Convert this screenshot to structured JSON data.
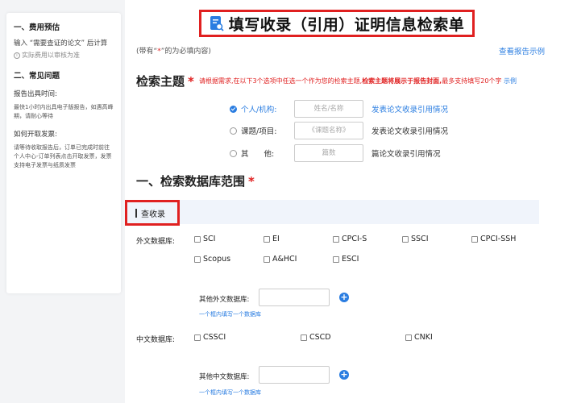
{
  "sidebar": {
    "section1_title": "一、费用预估",
    "section1_text": "输入 “需要查证的论文” 后计算",
    "section1_note": "实际费用以审核为准",
    "section2_title": "二、常见问题",
    "q1_title": "报告出具时间:",
    "q1_text": "最快1小时内出具电子版报告，如遇高峰期，请耐心等待",
    "q2_title": "如何开取发票:",
    "q2_text": "请等待收取报告后，订单已完成时前往个人中心-订单列表点击开取发票，发票支持电子发票与纸质发票"
  },
  "header": {
    "title": "填写收录（引用）证明信息检索单",
    "note_prefix": "(带有“",
    "note_star": "*",
    "note_suffix": "”的为必填内容)",
    "example_link": "查看报告示例"
  },
  "topic": {
    "title": "检索主题",
    "required_mark": "*",
    "hint_a": "请根据需求,在以下3个选项中任选一个作为您的检索主题,",
    "hint_b": "检索主题将展示于报告封面,",
    "hint_c": "最多支持填写20个字",
    "hint_link": "示例",
    "options": [
      {
        "label": "个人/机构:",
        "placeholder": "姓名/名称",
        "desc": "发表论文收录引用情况",
        "checked": true
      },
      {
        "label": "课题/项目:",
        "placeholder": "《课题名称》",
        "desc": "发表论文收录引用情况",
        "checked": false
      },
      {
        "label": "其　　他:",
        "placeholder": "篇数",
        "desc": "篇论文收录引用情况",
        "checked": false
      }
    ]
  },
  "scope": {
    "title": "一、检索数据库范围",
    "required_mark": "*",
    "tab_label": "查收录",
    "foreign_label": "外文数据库:",
    "foreign_dbs": [
      "SCI",
      "EI",
      "CPCI-S",
      "SSCI",
      "CPCI-SSH",
      "Scopus",
      "A&HCI",
      "ESCI"
    ],
    "other_foreign_label": "其他外文数据库:",
    "other_foreign_hint": "一个框内填写一个数据库",
    "chinese_label": "中文数据库:",
    "chinese_dbs": [
      "CSSCI",
      "CSCD",
      "CNKI"
    ],
    "other_chinese_label": "其他中文数据库:",
    "other_chinese_hint": "一个框内填写一个数据库"
  },
  "colors": {
    "accent": "#2a7de1",
    "highlight_border": "#e02020"
  }
}
